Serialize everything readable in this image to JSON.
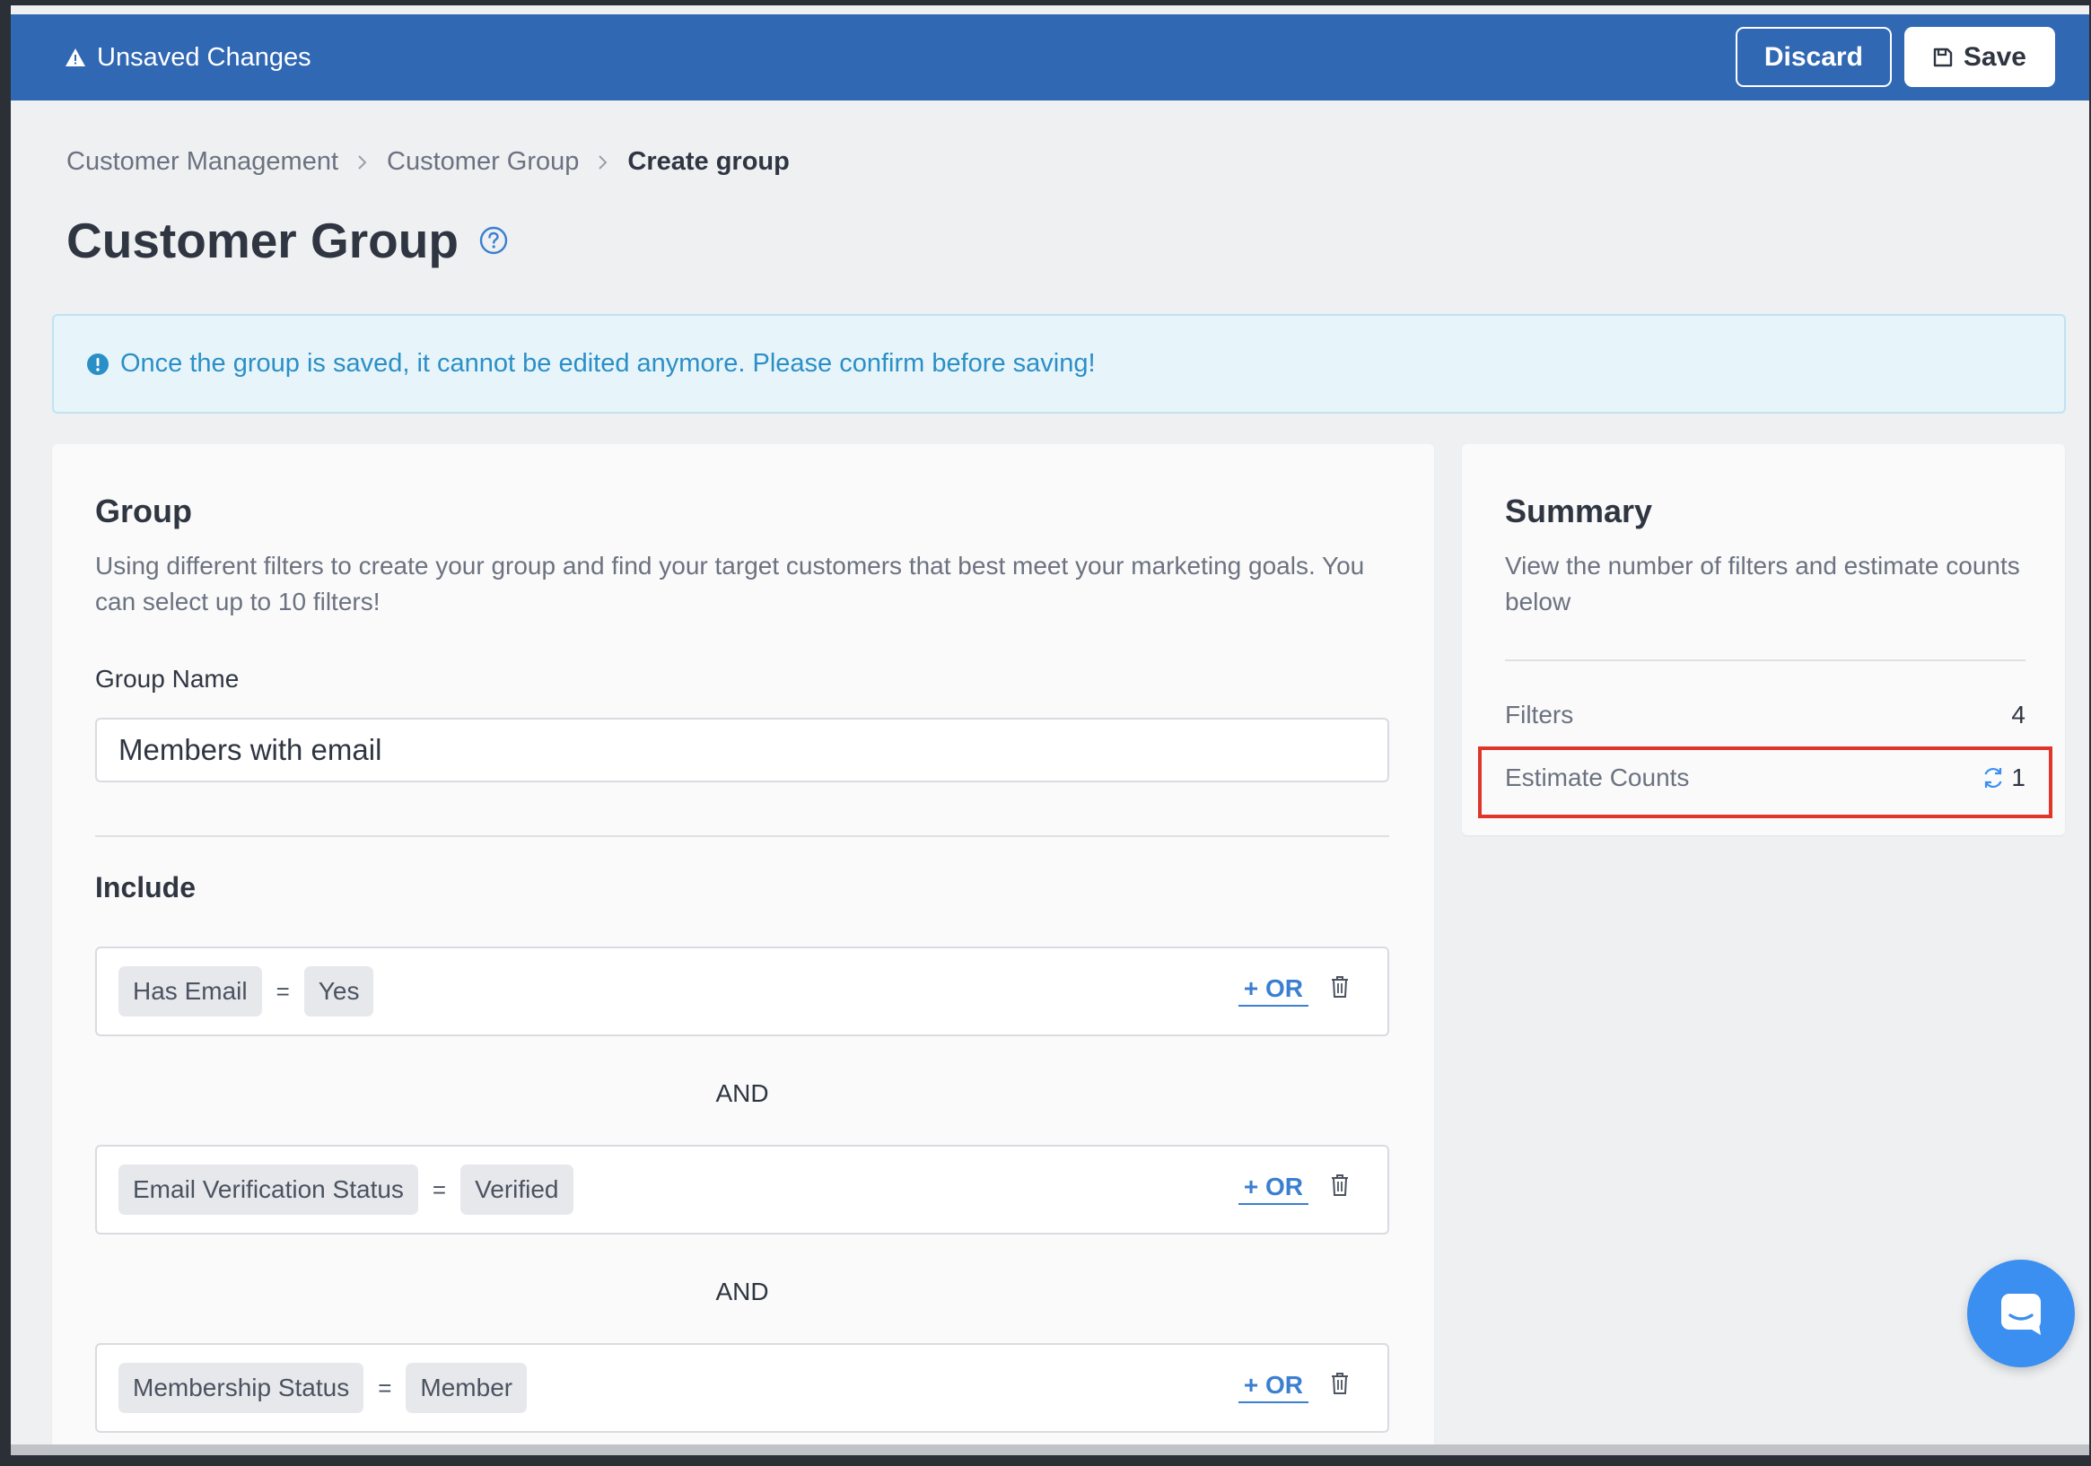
{
  "topbar": {
    "status_text": "Unsaved Changes",
    "discard_label": "Discard",
    "save_label": "Save",
    "color": "#3168b4"
  },
  "breadcrumb": [
    "Customer Management",
    "Customer Group",
    "Create group"
  ],
  "page": {
    "title": "Customer Group"
  },
  "notice": {
    "text": "Once the group is saved, it cannot be edited anymore. Please confirm before saving!",
    "color": "#2b8fc7"
  },
  "group": {
    "title": "Group",
    "description": "Using different filters to create your group and find your target customers that best meet your marketing goals. You can select up to 10 filters!",
    "name_label": "Group Name",
    "name_value": "Members with email",
    "include_title": "Include",
    "and_label": "AND",
    "or_label": "+ OR",
    "rules": [
      {
        "field": "Has Email",
        "operator": "=",
        "value": "Yes"
      },
      {
        "field": "Email Verification Status",
        "operator": "=",
        "value": "Verified"
      },
      {
        "field": "Membership Status",
        "operator": "=",
        "value": "Member"
      }
    ]
  },
  "summary": {
    "title": "Summary",
    "description": "View the number of filters and estimate counts below",
    "filters_label": "Filters",
    "filters_value": "4",
    "estimate_label": "Estimate Counts",
    "estimate_value": "1",
    "highlight_color": "#e0352b"
  },
  "icons": {
    "warning": "warning-icon",
    "save": "floppy-disk-icon",
    "chevron": "chevron-right-icon",
    "help": "question-circle-icon",
    "info": "exclamation-circle-icon",
    "trash": "trash-icon",
    "refresh": "refresh-icon",
    "chat": "chat-icon"
  }
}
